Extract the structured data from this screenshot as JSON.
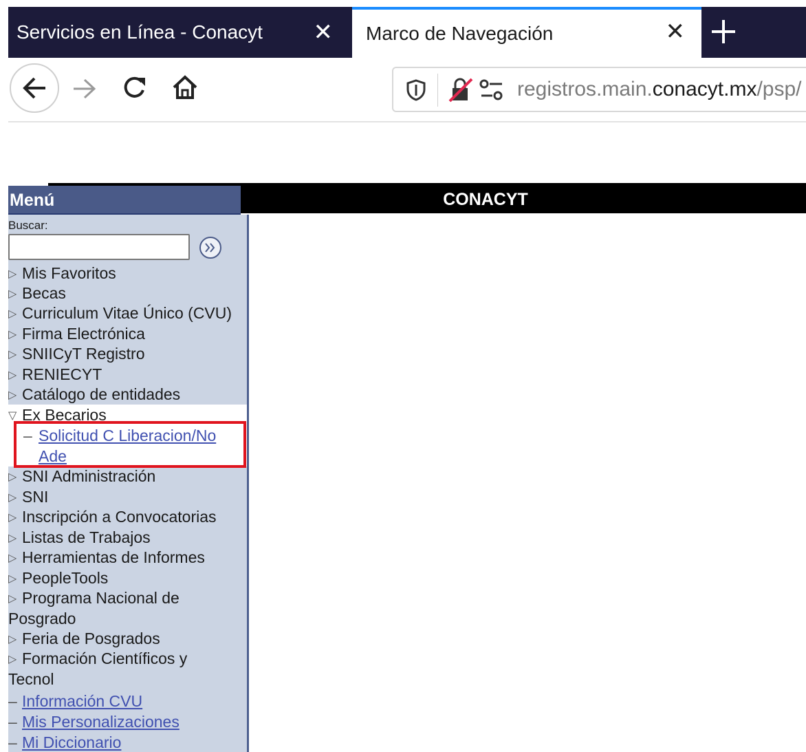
{
  "browser": {
    "tabs": [
      {
        "title": "Servicios en Línea - Conacyt",
        "active": false
      },
      {
        "title": "Marco de Navegación",
        "active": true
      }
    ],
    "url_prefix": "registros.main.",
    "url_domain": "conacyt.mx",
    "url_suffix": "/psp/",
    "accent_color": "#1a8cff",
    "tabstrip_color": "#1c1b3a"
  },
  "header": {
    "menu_title": "Menú",
    "brand": "CONACYT"
  },
  "sidebar": {
    "search_label": "Buscar:",
    "search_value": "",
    "items": [
      "Mis Favoritos",
      "Becas",
      "Curriculum Vitae Único (CVU)",
      "Firma Electrónica",
      "SNIICyT Registro",
      "RENIECYT",
      "Catálogo de entidades",
      "Ex Becarios",
      "SNI Administración",
      "SNI",
      "Inscripción a Convocatorias",
      "Listas de Trabajos",
      "Herramientas de Informes",
      "PeopleTools"
    ],
    "expanded_sub": {
      "line1": "Solicitud C Liberacion/No",
      "line2": "Ade"
    },
    "wrapped": {
      "posgrado_1": "Programa Nacional de",
      "posgrado_2": "Posgrado",
      "feria": "Feria de Posgrados",
      "formacion_1": "Formación Científicos y",
      "formacion_2": "Tecnol"
    },
    "links": [
      "Información CVU",
      "Mis Personalizaciones",
      "Mi Diccionario"
    ],
    "highlight_color": "#e0141e",
    "link_color": "#4050b0"
  }
}
